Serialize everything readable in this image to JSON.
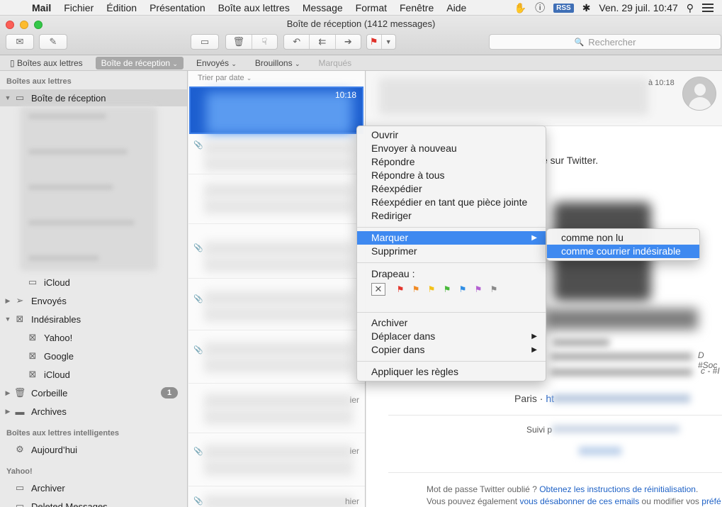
{
  "menubar": {
    "app_name": "Mail",
    "items": [
      "Fichier",
      "Édition",
      "Présentation",
      "Boîte aux lettres",
      "Message",
      "Format",
      "Fenêtre",
      "Aide"
    ],
    "rss": "RSS",
    "clock": "Ven. 29 juil.  10:47"
  },
  "window": {
    "title": "Boîte de réception (1412 messages)"
  },
  "search": {
    "placeholder": "Rechercher"
  },
  "favbar": {
    "mailboxes": "Boîtes aux lettres",
    "inbox": "Boîte de réception",
    "sent": "Envoyés",
    "drafts": "Brouillons",
    "flagged": "Marqués"
  },
  "sidebar": {
    "sec_mailboxes": "Boîtes aux lettres",
    "inbox": "Boîte de réception",
    "icloud": "iCloud",
    "sent": "Envoyés",
    "junk": "Indésirables",
    "junk_yahoo": "Yahoo!",
    "junk_google": "Google",
    "junk_icloud": "iCloud",
    "trash": "Corbeille",
    "trash_count": "1",
    "archives": "Archives",
    "sec_smart": "Boîtes aux lettres intelligentes",
    "today": "Aujourd’hui",
    "sec_yahoo": "Yahoo!",
    "archiver": "Archiver",
    "deleted": "Deleted Messages"
  },
  "msglist": {
    "sort_label": "Trier par date",
    "selected_time": "10:18",
    "suffix_ier_1": "ier",
    "suffix_ier_2": "ier",
    "suffix_hier": "hier"
  },
  "reader": {
    "header_time": "à 10:18",
    "twitter_snip": "é sur Twitter.",
    "paris": "Paris · ",
    "paris_link": "ht",
    "suivi": "Suivi p",
    "right_snip_1": "D #Soc",
    "right_snip_2": "c - #I",
    "footer_line1": "Mot de passe Twitter oublié ? ",
    "footer_link1": "Obtenez les instructions de réinitialisation",
    "footer_end1": ".",
    "footer_line2": "Vous pouvez également ",
    "footer_link2": "vous désabonner de ces emails",
    "footer_mid2": " ou modifier vos ",
    "footer_link3": "préfé"
  },
  "context_menu": {
    "open": "Ouvrir",
    "resend": "Envoyer à nouveau",
    "reply": "Répondre",
    "reply_all": "Répondre à tous",
    "forward": "Réexpédier",
    "forward_attachment": "Réexpédier en tant que pièce jointe",
    "redirect": "Rediriger",
    "mark": "Marquer",
    "delete": "Supprimer",
    "flag_label": "Drapeau :",
    "archive": "Archiver",
    "move_to": "Déplacer dans",
    "copy_to": "Copier dans",
    "apply_rules": "Appliquer les règles",
    "flag_colors": [
      "#e3362d",
      "#f08a24",
      "#f3c21a",
      "#48b93a",
      "#2f8de4",
      "#b45fd1",
      "#8a8a8a"
    ]
  },
  "submenu": {
    "unread": "comme non lu",
    "junk": "comme courrier indésirable"
  },
  "colors": {
    "highlight": "#3e89f0",
    "selection": "#1d5fd0",
    "flag_red": "#e0312a"
  }
}
